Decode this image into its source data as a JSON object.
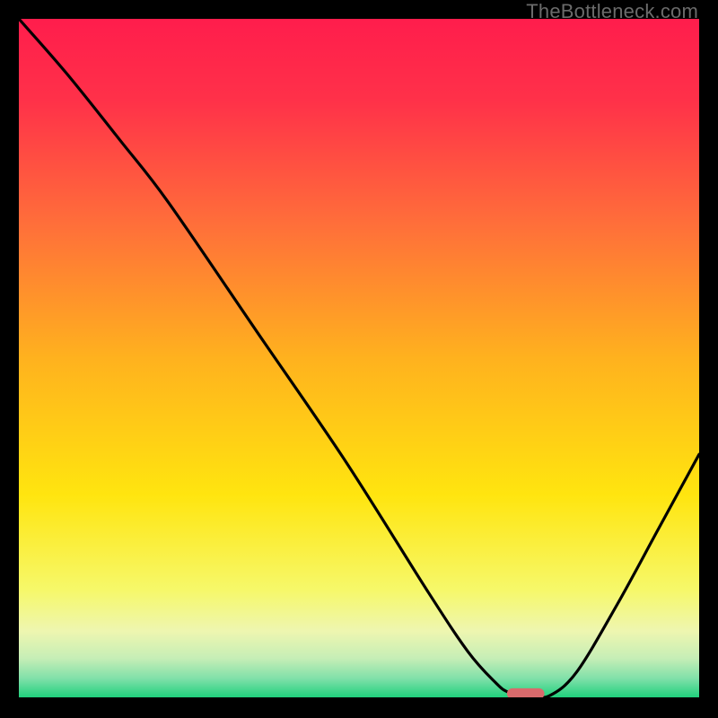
{
  "watermark": "TheBottleneck.com",
  "chart_data": {
    "type": "line",
    "title": "",
    "xlabel": "",
    "ylabel": "",
    "xlim": [
      0,
      100
    ],
    "ylim": [
      0,
      100
    ],
    "grid": false,
    "legend": false,
    "gradient_stops": [
      {
        "offset": 0.0,
        "color": "#ff1d4c"
      },
      {
        "offset": 0.12,
        "color": "#ff3149"
      },
      {
        "offset": 0.3,
        "color": "#ff6e3a"
      },
      {
        "offset": 0.5,
        "color": "#ffb21e"
      },
      {
        "offset": 0.7,
        "color": "#ffe50f"
      },
      {
        "offset": 0.84,
        "color": "#f6f86a"
      },
      {
        "offset": 0.9,
        "color": "#eef6b0"
      },
      {
        "offset": 0.94,
        "color": "#c6eeb6"
      },
      {
        "offset": 0.97,
        "color": "#7fe0a9"
      },
      {
        "offset": 1.0,
        "color": "#17cf78"
      }
    ],
    "series": [
      {
        "name": "bottleneck-curve",
        "x": [
          0.0,
          7.0,
          15.0,
          22.0,
          35.0,
          48.0,
          60.0,
          66.0,
          70.0,
          72.0,
          75.0,
          78.0,
          82.0,
          88.0,
          94.0,
          100.0
        ],
        "y": [
          100.0,
          92.0,
          82.0,
          73.0,
          54.0,
          35.0,
          16.0,
          7.0,
          2.5,
          1.0,
          0.5,
          0.5,
          4.0,
          14.0,
          25.0,
          36.0
        ]
      }
    ],
    "marker": {
      "shape": "capsule",
      "x": 74.5,
      "y": 0.8,
      "width_pct": 5.5,
      "height_pct": 1.6,
      "color": "#d96a6c"
    }
  }
}
